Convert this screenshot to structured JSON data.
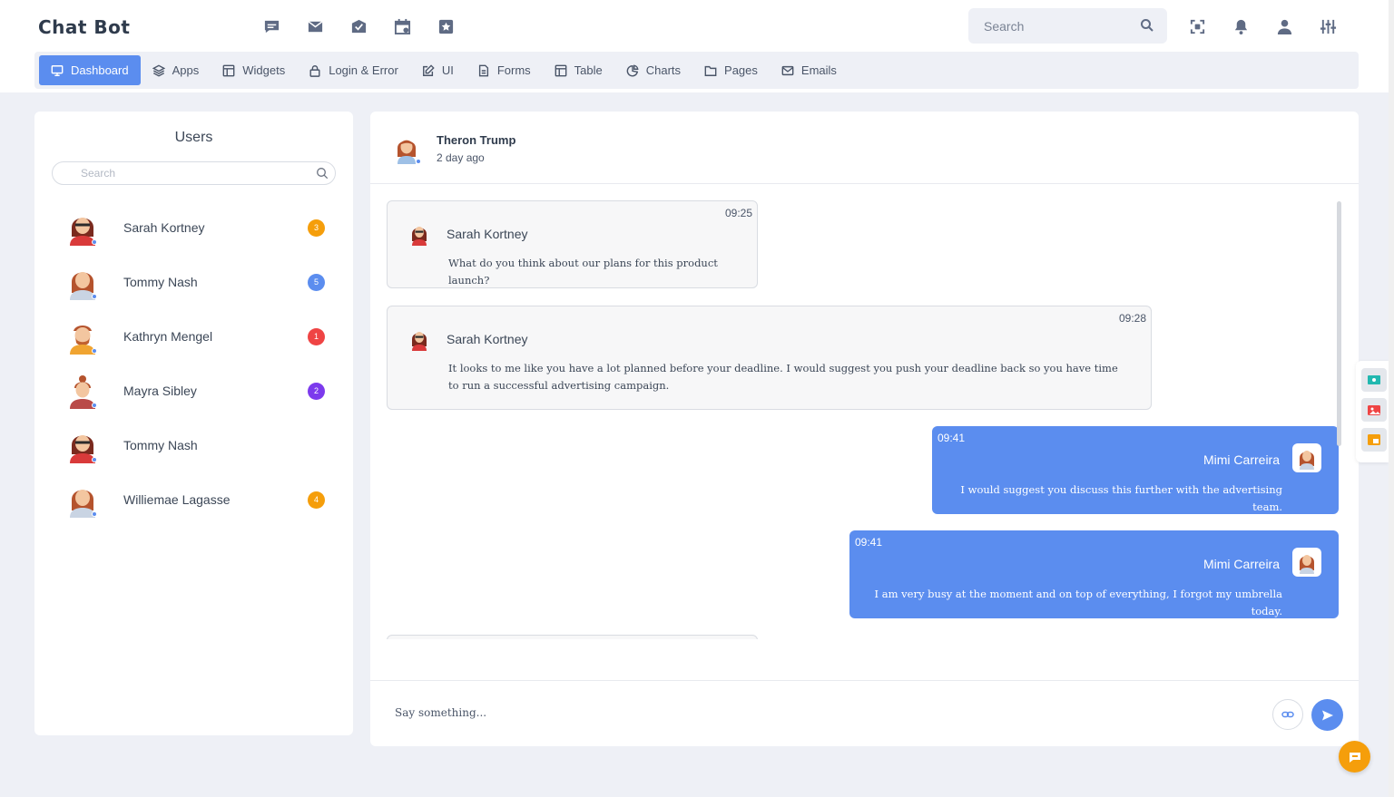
{
  "app": {
    "brand": "Chat Bot"
  },
  "header": {
    "quick_icons": [
      "chat-bubble-icon",
      "mail-icon",
      "mail-check-icon",
      "calendar-icon",
      "star-icon"
    ],
    "search_placeholder": "Search",
    "right_icons": [
      "fullscreen-icon",
      "bell-icon",
      "user-icon",
      "sliders-icon"
    ]
  },
  "nav": {
    "items": [
      {
        "label": "Dashboard",
        "icon": "monitor-icon",
        "active": true
      },
      {
        "label": "Apps",
        "icon": "layers-icon"
      },
      {
        "label": "Widgets",
        "icon": "layout-icon"
      },
      {
        "label": "Login & Error",
        "icon": "lock-icon"
      },
      {
        "label": "UI",
        "icon": "edit-icon"
      },
      {
        "label": "Forms",
        "icon": "file-icon"
      },
      {
        "label": "Table",
        "icon": "table-icon"
      },
      {
        "label": "Charts",
        "icon": "pie-chart-icon"
      },
      {
        "label": "Pages",
        "icon": "folder-icon"
      },
      {
        "label": "Emails",
        "icon": "envelope-icon"
      }
    ]
  },
  "users": {
    "title": "Users",
    "search_placeholder": "Search",
    "list": [
      {
        "name": "Sarah Kortney",
        "badge": "3",
        "badge_color": "#f59e0b",
        "avatar": "woman-glasses"
      },
      {
        "name": "Tommy Nash",
        "badge": "5",
        "badge_color": "#5b8def",
        "avatar": "woman-gray"
      },
      {
        "name": "Kathryn Mengel",
        "badge": "1",
        "badge_color": "#ef4444",
        "avatar": "man-beard"
      },
      {
        "name": "Mayra Sibley",
        "badge": "2",
        "badge_color": "#7c3aed",
        "avatar": "woman-bun"
      },
      {
        "name": "Tommy Nash",
        "badge": "",
        "badge_color": "",
        "avatar": "woman-glasses"
      },
      {
        "name": "Williemae Lagasse",
        "badge": "4",
        "badge_color": "#f59e0b",
        "avatar": "woman-gray"
      }
    ]
  },
  "chat": {
    "contact_name": "Theron Trump",
    "contact_status": "2 day ago",
    "messages": [
      {
        "direction": "in",
        "time": "09:25",
        "sender": "Sarah Kortney",
        "text": "What do you think about our plans for this product launch?"
      },
      {
        "direction": "in",
        "time": "09:28",
        "sender": "Sarah Kortney",
        "text": "It looks to me like you have a lot planned before your deadline. I would suggest you push your deadline back so you have time to run a successful advertising campaign."
      },
      {
        "direction": "out",
        "time": "09:41",
        "sender": "Mimi Carreira",
        "text": "I would suggest you discuss this further with the advertising team."
      },
      {
        "direction": "out",
        "time": "09:41",
        "sender": "Mimi Carreira",
        "text": "I am very busy at the moment and on top of everything, I forgot my umbrella today."
      }
    ],
    "composer_placeholder": "Say something..."
  },
  "colors": {
    "accent": "#5b8def",
    "background": "#eef0f6",
    "fab": "#f59e0b"
  }
}
